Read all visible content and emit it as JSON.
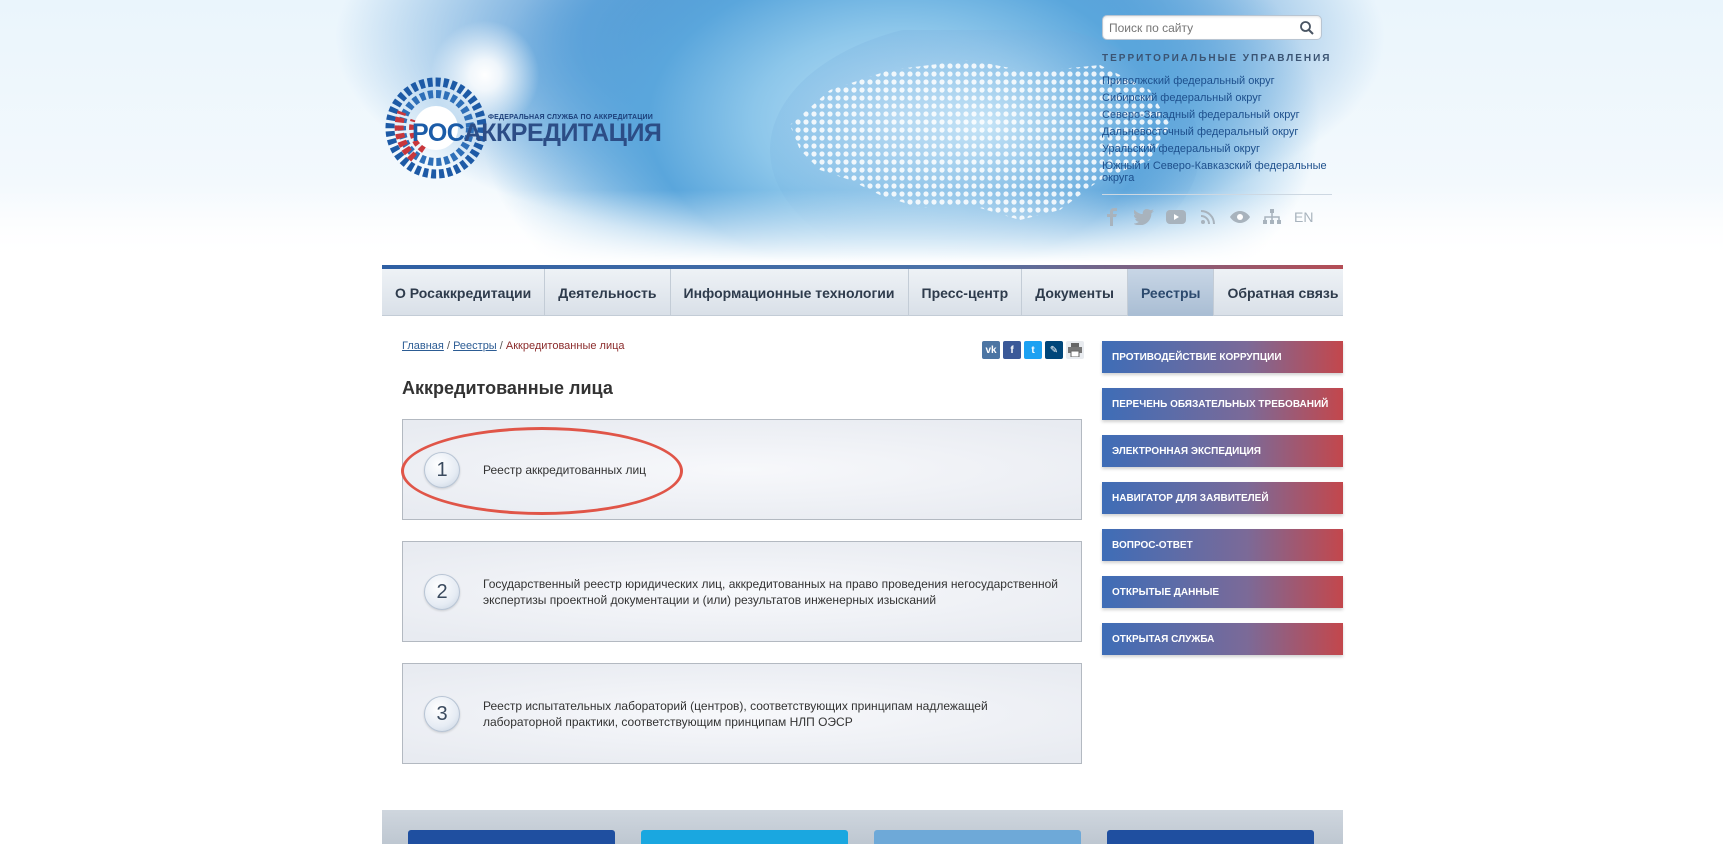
{
  "header": {
    "logo_subtitle": "ФЕДЕРАЛЬНАЯ СЛУЖБА ПО АККРЕДИТАЦИИ",
    "logo_title_prefix": "РОС",
    "logo_title_rest": "АККРЕДИТАЦИЯ",
    "search_placeholder": "Поиск по сайту",
    "territorial_title": "ТЕРРИТОРИАЛЬНЫЕ УПРАВЛЕНИЯ",
    "territorial_items": [
      "Приволжский федеральный округ",
      "Сибирский федеральный округ",
      "Северо-Западный федеральный округ",
      "Дальневосточный федеральный округ",
      "Уральский федеральный округ",
      "Южный и Северо-Кавказский федеральные округа"
    ],
    "lang_label": "EN",
    "social_icons": [
      "facebook-icon",
      "twitter-icon",
      "youtube-icon",
      "rss-icon",
      "eye-icon",
      "sitemap-icon"
    ]
  },
  "nav": {
    "items": [
      "О Росаккредитации",
      "Деятельность",
      "Информационные технологии",
      "Пресс-центр",
      "Документы",
      "Реестры",
      "Обратная связь"
    ],
    "active": "Реестры"
  },
  "breadcrumb": {
    "home": "Главная",
    "sep": "/",
    "section": "Реестры",
    "current": "Аккредитованные лица"
  },
  "share_icons": [
    "vk-icon",
    "facebook-icon",
    "twitter-icon",
    "livejournal-icon",
    "print-icon"
  ],
  "main": {
    "title": "Аккредитованные лица",
    "cards": [
      {
        "num": "1",
        "text": "Реестр аккредитованных лиц"
      },
      {
        "num": "2",
        "text": "Государственный реестр юридических лиц, аккредитованных на право проведения негосударственной экспертизы проектной документации и (или) результатов инженерных изысканий"
      },
      {
        "num": "3",
        "text": "Реестр испытательных лабораторий (центров), соответствующих принципам надлежащей лабораторной практики, соответствующим принципам НЛП ОЭСР"
      }
    ]
  },
  "sidebar": {
    "buttons": [
      "ПРОТИВОДЕЙСТВИЕ КОРРУПЦИИ",
      "ПЕРЕЧЕНЬ ОБЯЗАТЕЛЬНЫХ ТРЕБОВАНИЙ",
      "ЭЛЕКТРОННАЯ ЭКСПЕДИЦИЯ",
      "НАВИГАТОР ДЛЯ ЗАЯВИТЕЛЕЙ",
      "ВОПРОС-ОТВЕТ",
      "ОТКРЫТЫЕ ДАННЫЕ",
      "ОТКРЫТАЯ СЛУЖБА"
    ]
  },
  "colors": {
    "accent_blue": "#1b5ca8",
    "highlight_red": "#e05548",
    "breadcrumb_current": "#8b2c2c"
  }
}
